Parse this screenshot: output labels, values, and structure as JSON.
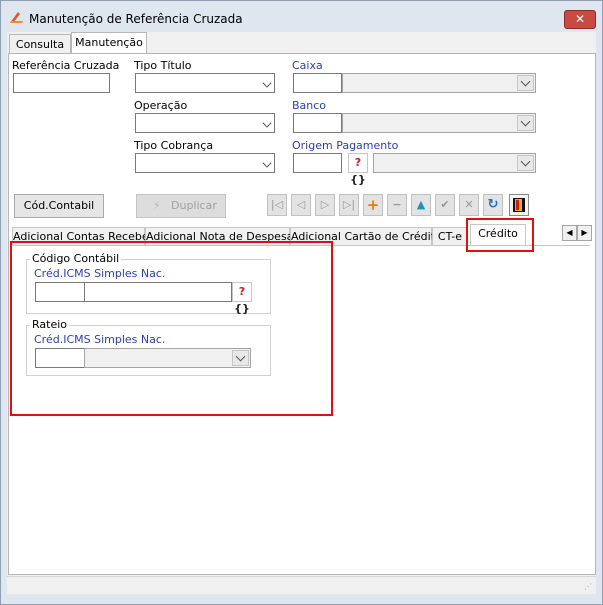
{
  "window": {
    "title": "Manutenção de Referência Cruzada",
    "close_label": "✕"
  },
  "outer_tabs": [
    {
      "label": "Consulta"
    },
    {
      "label": "Manutenção"
    }
  ],
  "form": {
    "referencia_cruzada": {
      "label": "Referência Cruzada",
      "value": ""
    },
    "tipo_titulo": {
      "label": "Tipo Título",
      "value": ""
    },
    "operacao": {
      "label": "Operação",
      "value": ""
    },
    "tipo_cobranca": {
      "label": "Tipo Cobrança",
      "value": ""
    },
    "caixa": {
      "label": "Caixa",
      "code": "",
      "value": ""
    },
    "banco": {
      "label": "Banco",
      "code": "",
      "value": ""
    },
    "origem_pagamento": {
      "label": "Origem Pagamento",
      "code": "",
      "value": ""
    }
  },
  "buttons": {
    "cod_contabil": "Cód.Contabil",
    "duplicar": "Duplicar"
  },
  "navigator": [
    {
      "icon": "first-record-icon",
      "glyph": "|◁"
    },
    {
      "icon": "prior-record-icon",
      "glyph": "◁"
    },
    {
      "icon": "next-record-icon",
      "glyph": "▷"
    },
    {
      "icon": "last-record-icon",
      "glyph": "▷|"
    },
    {
      "icon": "insert-icon",
      "glyph": "+"
    },
    {
      "icon": "delete-icon",
      "glyph": "−"
    },
    {
      "icon": "edit-icon",
      "glyph": "▲"
    },
    {
      "icon": "post-icon",
      "glyph": "✔"
    },
    {
      "icon": "cancel-icon",
      "glyph": "✕"
    },
    {
      "icon": "refresh-icon",
      "glyph": "↻"
    },
    {
      "icon": "exit-door-icon",
      "glyph": ""
    }
  ],
  "inner_tabs": [
    {
      "label": "Adicional Contas Receber"
    },
    {
      "label": "Adicional Nota de Despesas"
    },
    {
      "label": "Adicional Cartão de Crédito"
    },
    {
      "label": "CT-e"
    },
    {
      "label": "Crédito"
    }
  ],
  "credito": {
    "codigo_contabil": {
      "title": "Código Contábil",
      "field_label": "Créd.ICMS Simples Nac.",
      "code": "",
      "value": ""
    },
    "rateio": {
      "title": "Rateio",
      "field_label": "Créd.ICMS Simples Nac.",
      "code": "",
      "value": ""
    }
  },
  "lookup_icon_text": {
    "q": "?",
    "b": "{}"
  },
  "colors": {
    "highlight": "#e01010",
    "label_blue": "#2b3fb0",
    "close_red": "#c84a42"
  }
}
